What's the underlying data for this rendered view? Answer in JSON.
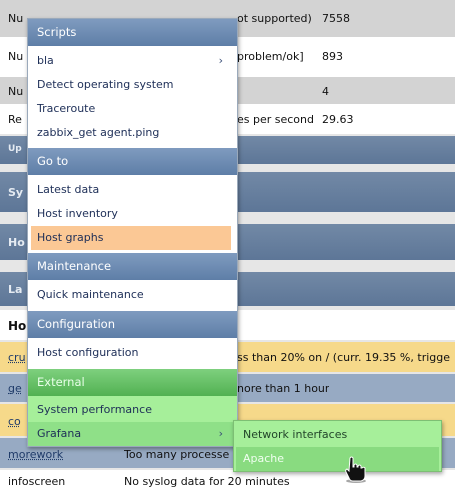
{
  "background": {
    "rows": [
      {
        "label": "Nu",
        "mid": "ot supported)",
        "value": "7558"
      },
      {
        "label": "Nu",
        "mid": "problem/ok]",
        "value": "893"
      },
      {
        "label": "Nu",
        "mid": "",
        "value": "4"
      },
      {
        "label": "Re",
        "mid": "es per second",
        "value": "29.63"
      }
    ],
    "headers": [
      "Up",
      "Sy",
      "Ho",
      "La"
    ],
    "bold_label": "Ho",
    "triggers": [
      {
        "label": "cru",
        "text": "ss than 20% on / (curr. 19.35 %, trigge"
      },
      {
        "label": "ge",
        "text": "nore than 1 hour"
      },
      {
        "label": "co",
        "text": ""
      },
      {
        "label": "morework",
        "text": "Too many processe"
      },
      {
        "label": "infoscreen",
        "text": "No syslog data for 20 minutes"
      }
    ]
  },
  "menu": {
    "scripts": {
      "title": "Scripts",
      "items": [
        "bla",
        "Detect operating system",
        "Traceroute",
        "zabbix_get agent.ping"
      ]
    },
    "goto": {
      "title": "Go to",
      "items": [
        "Latest data",
        "Host inventory",
        "Host graphs"
      ]
    },
    "maintenance": {
      "title": "Maintenance",
      "items": [
        "Quick maintenance"
      ]
    },
    "configuration": {
      "title": "Configuration",
      "items": [
        "Host configuration"
      ]
    },
    "external": {
      "title": "External",
      "items": [
        "System performance",
        "Grafana"
      ]
    },
    "arrow": "›"
  },
  "submenu": {
    "items": [
      "Network interfaces",
      "Apache"
    ]
  },
  "colors": {
    "section_blue": "#6e8db5",
    "section_green": "#5fbf5f",
    "highlight_orange": "#fbc895",
    "external_green": "#a6ef9a"
  }
}
